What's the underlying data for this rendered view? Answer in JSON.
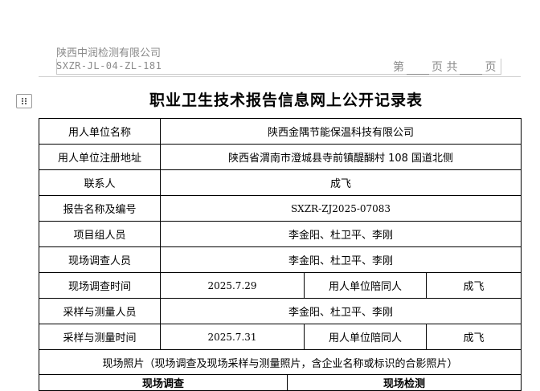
{
  "header": {
    "company": "陕西中润检测有限公司",
    "doc_code": "SXZR-JL-04-ZL-181",
    "page_prefix": "第",
    "page_mid": "页 共",
    "page_suffix": "页"
  },
  "title": "职业卫生技术报告信息网上公开记录表",
  "rows": {
    "employer_name": {
      "label": "用人单位名称",
      "value": "陕西金隅节能保温科技有限公司"
    },
    "employer_address": {
      "label": "用人单位注册地址",
      "value": "陕西省渭南市澄城县寺前镇醍醐村 108 国道北侧"
    },
    "contact": {
      "label": "联系人",
      "value": "成飞"
    },
    "report_no": {
      "label": "报告名称及编号",
      "value": "SXZR-ZJ2025-07083"
    },
    "team": {
      "label": "项目组人员",
      "value": "李金阳、杜卫平、李刚"
    },
    "survey_staff": {
      "label": "现场调查人员",
      "value": "李金阳、杜卫平、李刚"
    },
    "survey_time": {
      "label": "现场调查时间",
      "value": "2025.7.29",
      "companion_label": "用人单位陪同人",
      "companion": "成飞"
    },
    "sampling_staff": {
      "label": "采样与测量人员",
      "value": "李金阳、杜卫平、李刚"
    },
    "sampling_time": {
      "label": "采样与测量时间",
      "value": "2025.7.31",
      "companion_label": "用人单位陪同人",
      "companion": "成飞"
    }
  },
  "photos": {
    "header": "现场照片（现场调查及现场采样与测量照片，含企业名称或标识的合影照片）",
    "col_survey": "现场调查",
    "col_testing": "现场检测"
  }
}
